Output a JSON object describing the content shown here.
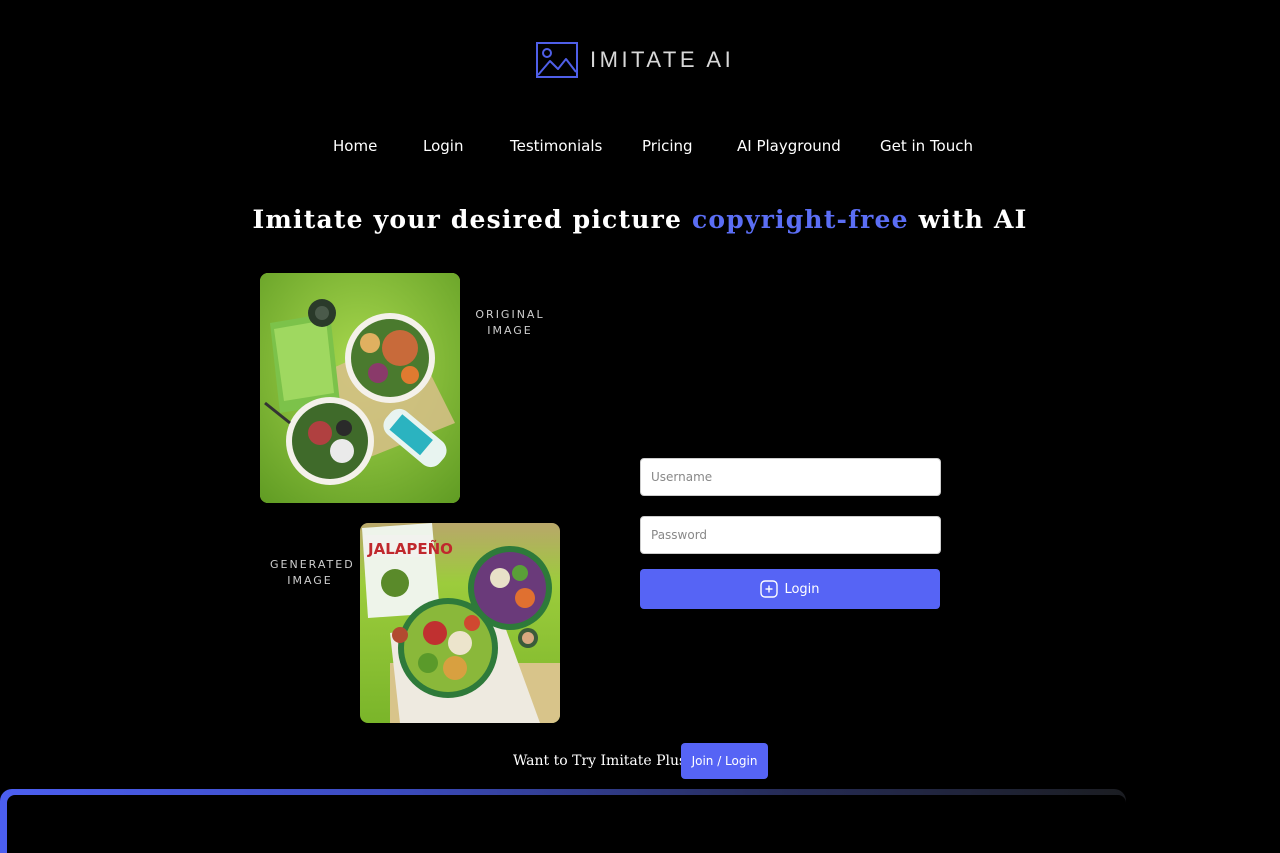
{
  "brand": {
    "name": "IMITATE AI",
    "icon": "image-frame-icon",
    "accent_color": "#5b6ef5"
  },
  "nav": {
    "items": [
      {
        "label": "Home"
      },
      {
        "label": "Login"
      },
      {
        "label": "Testimonials"
      },
      {
        "label": "Pricing"
      },
      {
        "label": "AI Playground"
      },
      {
        "label": "Get in Touch"
      }
    ]
  },
  "hero": {
    "headline_pre": "Imitate your desired picture ",
    "headline_accent": "copyright-free",
    "headline_post": " with AI"
  },
  "gallery": {
    "original_caption_line1": "ORIGINAL",
    "original_caption_line2": "IMAGE",
    "generated_caption_line1": "GENERATED",
    "generated_caption_line2": "IMAGE",
    "generated_bag_text": "JALAPEÑO"
  },
  "login_form": {
    "username_placeholder": "Username",
    "password_placeholder": "Password",
    "submit_label": "Login",
    "submit_icon": "login-square-icon",
    "button_color": "#5664f5"
  },
  "promo": {
    "text": "Want to Try Imitate Plus?",
    "button_label": "Join / Login"
  }
}
